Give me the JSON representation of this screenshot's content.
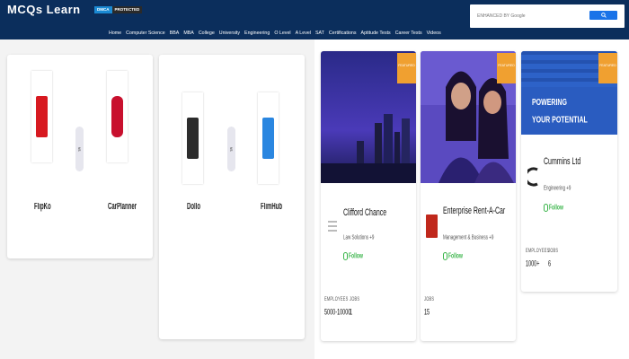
{
  "header": {
    "logo": "MCQs Learn",
    "badge_left": "DMCA",
    "badge_right": "PROTECTED",
    "search_placeholder": "ENHANCED BY Google",
    "nav": [
      "Home",
      "Computer Science",
      "BBA",
      "MBA",
      "College",
      "University",
      "Engineering",
      "O Level",
      "A Level",
      "SAT",
      "Certifications",
      "Aptitude Tests",
      "Career Tests",
      "Videos"
    ]
  },
  "comparisons": [
    {
      "left": {
        "name": "FlipKo",
        "color": "#d71920"
      },
      "vs": "vs",
      "right": {
        "name": "CarPlanner",
        "color": "#c8102e"
      }
    },
    {
      "left": {
        "name": "Dollo",
        "color": "#2c2c2c"
      },
      "vs": "vs",
      "right": {
        "name": "FlimHub",
        "color": "#2a86e0"
      }
    }
  ],
  "employers": [
    {
      "name": "Clifford Chance",
      "category": "Law Solutions +9",
      "follow": "Follow",
      "featured": "FEATURED",
      "employees_label": "EMPLOYEES",
      "jobs_label": "JOBS",
      "employees": "5000-10000",
      "jobs": "1"
    },
    {
      "name": "Enterprise Rent-A-Car",
      "category": "Management & Business +9",
      "follow": "Follow",
      "featured": "FEATURED",
      "employees_label": "",
      "jobs_label": "JOBS",
      "employees": "",
      "jobs": "15"
    },
    {
      "name": "Cummins Ltd",
      "category": "Engineering +9",
      "follow": "Follow",
      "featured": "FEATURED",
      "employees_label": "EMPLOYEES",
      "jobs_label": "JOBS",
      "employees": "1000+",
      "jobs": "6",
      "banner_text_1": "POWERING",
      "banner_text_2": "YOUR POTENTIAL"
    }
  ]
}
